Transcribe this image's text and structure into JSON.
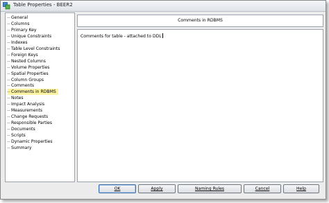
{
  "window": {
    "title": "Table Properties - BEER2"
  },
  "tree": {
    "items": [
      "General",
      "Columns",
      "Primary Key",
      "Unique Constraints",
      "Indexes",
      "Table Level Constraints",
      "Foreign Keys",
      "Nested Columns",
      "Volume Properties",
      "Spatial Properties",
      "Column Groups",
      "Comments",
      "Comments in RDBMS",
      "Notes",
      "Impact Analysis",
      "Measurements",
      "Change Requests",
      "Responsible Parties",
      "Documents",
      "Scripts",
      "Dynamic Properties",
      "Summary"
    ],
    "selected_index": 12
  },
  "panel": {
    "header": "Comments in RDBMS",
    "comment_value": "Comments for table - attached to DDL"
  },
  "buttons": {
    "ok": "OK",
    "apply": "Apply",
    "naming_rules": "Naming Rules",
    "cancel": "Cancel",
    "help": "Help"
  },
  "colors": {
    "selection_highlight": "#fbf2a2",
    "window_bg": "#ececec"
  }
}
